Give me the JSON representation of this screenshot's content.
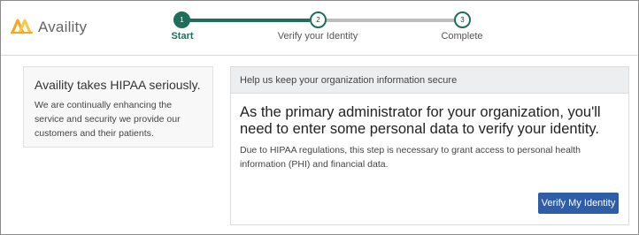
{
  "brand": {
    "name": "Availity"
  },
  "stepper": {
    "steps": [
      {
        "number": "1",
        "label": "Start"
      },
      {
        "number": "2",
        "label": "Verify your Identity"
      },
      {
        "number": "3",
        "label": "Complete"
      }
    ],
    "current_step": "1"
  },
  "info_card": {
    "title": "Availity takes HIPAA seriously.",
    "body": "We are continually enhancing the service and security we provide our customers and their patients."
  },
  "panel": {
    "header": "Help us keep your organization information secure",
    "lead": "As the primary administrator for your organization, you'll need to enter some personal data to verify your identity.",
    "text": "Due to HIPAA regulations, this step is necessary to grant access to personal health information (PHI) and financial data.",
    "button_label": "Verify My Identity"
  },
  "colors": {
    "accent_green": "#1f6e5a",
    "button_blue": "#2f5da8",
    "logo_orange": "#f5a623"
  }
}
